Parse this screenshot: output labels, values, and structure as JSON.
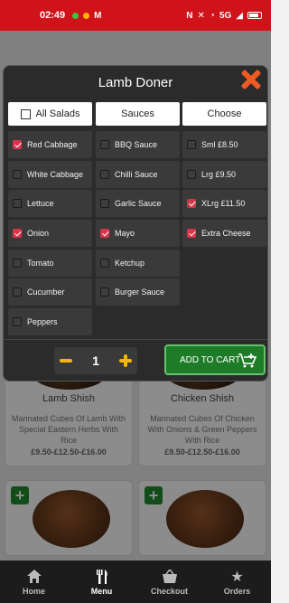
{
  "status_bar": {
    "time": "02:49",
    "signal": "5G"
  },
  "modal": {
    "title": "Lamb Doner",
    "columns": [
      {
        "header": "All Salads",
        "has_checkbox": true,
        "items": [
          {
            "label": "Red Cabbage",
            "checked": true
          },
          {
            "label": "White Cabbage",
            "checked": false
          },
          {
            "label": "Lettuce",
            "checked": false
          },
          {
            "label": "Onion",
            "checked": true
          },
          {
            "label": "Tomato",
            "checked": false
          },
          {
            "label": "Cucumber",
            "checked": false
          },
          {
            "label": "Peppers",
            "checked": false
          }
        ]
      },
      {
        "header": "Sauces",
        "has_checkbox": false,
        "items": [
          {
            "label": "BBQ Sauce",
            "checked": false
          },
          {
            "label": "Chilli Sauce",
            "checked": false
          },
          {
            "label": "Garlic Sauce",
            "checked": false
          },
          {
            "label": "Mayo",
            "checked": true
          },
          {
            "label": "Ketchup",
            "checked": false
          },
          {
            "label": "Burger Sauce",
            "checked": false
          }
        ]
      },
      {
        "header": "Choose",
        "has_checkbox": false,
        "items": [
          {
            "label": "Sml £8.50",
            "checked": false
          },
          {
            "label": "Lrg £9.50",
            "checked": false
          },
          {
            "label": "XLrg £11.50",
            "checked": true
          },
          {
            "label": "Extra Cheese",
            "checked": true
          }
        ]
      }
    ],
    "quantity": "1",
    "add_to_cart_label": "ADD TO CART"
  },
  "menu_cards": [
    {
      "name": "Lamb Shish",
      "description": "Marinated Cubes Of Lamb With Special Eastern Herbs With Rice",
      "price": "£9.50-£12.50-£16.00"
    },
    {
      "name": "Chicken Shish",
      "description": "Marinated Cubes Of Chicken With Onions & Green Peppers With Rice",
      "price": "£9.50-£12.50-£16.00"
    }
  ],
  "bottom_nav": [
    {
      "label": "Home",
      "icon": "home-icon",
      "active": false
    },
    {
      "label": "Menu",
      "icon": "menu-icon",
      "active": true
    },
    {
      "label": "Checkout",
      "icon": "basket-icon",
      "active": false
    },
    {
      "label": "Orders",
      "icon": "star-icon",
      "active": false
    }
  ],
  "colors": {
    "status_bar": "#d0131b",
    "checkbox_checked": "#d9344a",
    "close_icon": "#ee5a24",
    "quantity_controls": "#f2b705",
    "add_to_cart": "#1e7c28"
  }
}
